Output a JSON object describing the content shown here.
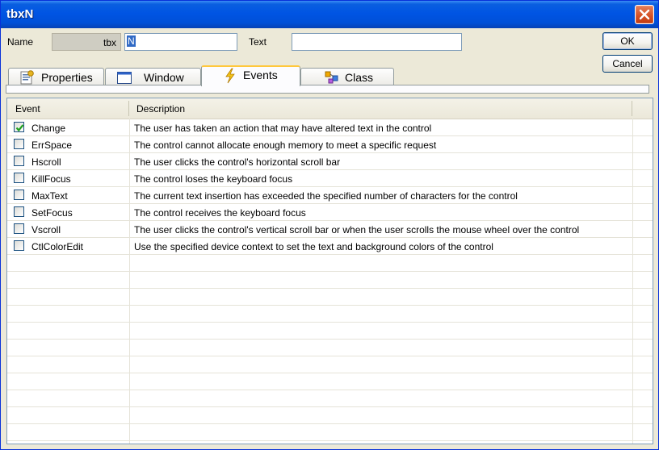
{
  "window": {
    "title": "tbxN"
  },
  "form": {
    "name_label": "Name",
    "tbx_label": "tbx",
    "name_value": "N",
    "text_label": "Text",
    "text_value": ""
  },
  "buttons": {
    "ok": "OK",
    "cancel": "Cancel"
  },
  "tabs": [
    {
      "label": "Properties",
      "icon": "properties-icon",
      "active": false
    },
    {
      "label": "Window",
      "icon": "window-icon",
      "active": false
    },
    {
      "label": "Events",
      "icon": "lightning-icon",
      "active": true
    },
    {
      "label": "Class",
      "icon": "class-icon",
      "active": false
    }
  ],
  "grid": {
    "columns": [
      "Event",
      "Description"
    ],
    "rows": [
      {
        "checked": true,
        "event": "Change",
        "description": "The user has taken an action that may have altered text in the control"
      },
      {
        "checked": false,
        "event": "ErrSpace",
        "description": "The control cannot allocate enough memory to meet a specific request"
      },
      {
        "checked": false,
        "event": "Hscroll",
        "description": "The user clicks the control's horizontal scroll bar"
      },
      {
        "checked": false,
        "event": "KillFocus",
        "description": "The control loses the keyboard focus"
      },
      {
        "checked": false,
        "event": "MaxText",
        "description": "The current text insertion has exceeded the specified number of characters for the control"
      },
      {
        "checked": false,
        "event": "SetFocus",
        "description": "The control receives the keyboard focus"
      },
      {
        "checked": false,
        "event": "Vscroll",
        "description": "The user clicks the control's vertical scroll bar or when the user scrolls the mouse wheel over the control"
      },
      {
        "checked": false,
        "event": "CtlColorEdit",
        "description": "Use the specified device context to set the text and background colors of the control"
      }
    ]
  },
  "colors": {
    "titlebar": "#0054e3",
    "close": "#d44f23",
    "active_tab_accent": "#ffc83c",
    "check": "#21a121"
  }
}
